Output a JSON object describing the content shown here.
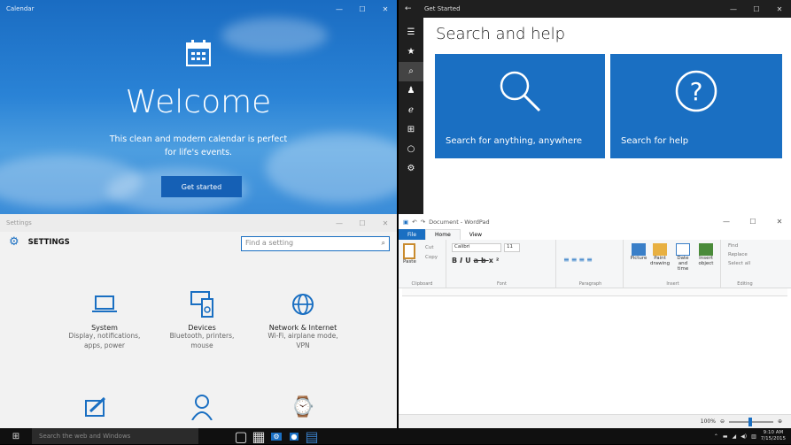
{
  "calendar": {
    "title": "Calendar",
    "controls": [
      "—",
      "☐",
      "✕"
    ],
    "welcome": "Welcome",
    "description_line1": "This clean and modern calendar is perfect",
    "description_line2": "for life's events.",
    "get_started_button": "Get started"
  },
  "get_started": {
    "title": "Get Started",
    "heading": "Search and help",
    "tiles": [
      {
        "label": "Search for anything, anywhere",
        "icon": "magnifier-icon"
      },
      {
        "label": "Search for help",
        "icon": "question-circle-icon"
      }
    ],
    "sidebar_icons": [
      "menu-icon",
      "star-icon",
      "search-icon",
      "people-icon",
      "edge-icon",
      "windows-icon",
      "cortana-icon",
      "gear-icon"
    ]
  },
  "settings": {
    "title": "Settings",
    "header": "SETTINGS",
    "search_placeholder": "Find a setting",
    "categories": [
      {
        "name": "System",
        "desc1": "Display, notifications,",
        "desc2": "apps, power"
      },
      {
        "name": "Devices",
        "desc1": "Bluetooth, printers,",
        "desc2": "mouse"
      },
      {
        "name": "Network & Internet",
        "desc1": "Wi-Fi, airplane mode,",
        "desc2": "VPN"
      }
    ]
  },
  "wordpad": {
    "title": "Document - WordPad",
    "tabs": [
      "File",
      "Home",
      "View"
    ],
    "font_name": "Calibri",
    "font_size": "11",
    "groups": [
      "Clipboard",
      "Font",
      "Paragraph",
      "Insert",
      "Editing"
    ],
    "clipboard": {
      "paste": "Paste",
      "cut": "Cut",
      "copy": "Copy"
    },
    "insert": {
      "picture": "Picture",
      "paint": "Paint drawing",
      "datetime": "Date and time",
      "object": "Insert object"
    },
    "editing": {
      "find": "Find",
      "replace": "Replace",
      "select_all": "Select all"
    },
    "zoom": "100%"
  },
  "taskbar": {
    "search_placeholder": "Search the web and Windows",
    "time": "9:10 AM",
    "date": "7/15/2015"
  },
  "colors": {
    "accent": "#1a6fc2",
    "taskbar": "#101010"
  }
}
